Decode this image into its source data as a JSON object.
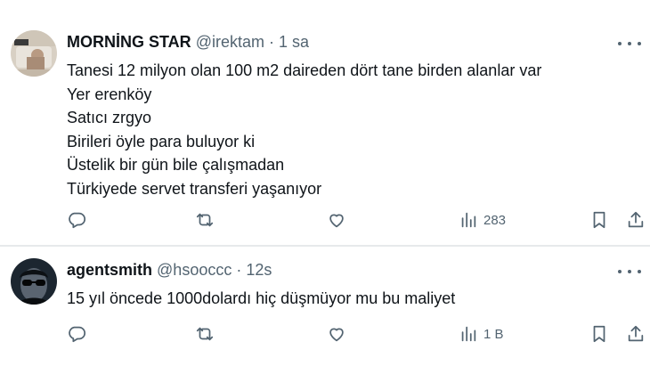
{
  "tweets": [
    {
      "display_name": "MORNİNG STAR",
      "handle": "@irektam",
      "separator": "·",
      "time": "1 sa",
      "lines": [
        "Tanesi 12 milyon olan 100 m2 daireden dört tane birden alanlar var",
        "Yer erenköy",
        "Satıcı zrgyo",
        "Birileri öyle para buluyor ki",
        "Üstelik bir gün bile çalışmadan",
        "Türkiyede servet transferi yaşanıyor"
      ],
      "views": "283"
    },
    {
      "display_name": "agentsmith",
      "handle": "@hsooccc",
      "separator": "·",
      "time": "12s",
      "lines": [
        "15 yıl öncede 1000dolardı hiç düşmüyor mu bu maliyet"
      ],
      "views": "1 B"
    }
  ],
  "icons": {
    "more": "more-dots-icon",
    "reply": "reply-bubble-icon",
    "retweet": "retweet-arrows-icon",
    "like": "heart-icon",
    "views": "bar-chart-icon",
    "bookmark": "bookmark-icon",
    "share": "share-upload-icon"
  },
  "colors": {
    "text": "#0f1419",
    "secondary": "#536471",
    "divider": "#e7e9eb"
  }
}
